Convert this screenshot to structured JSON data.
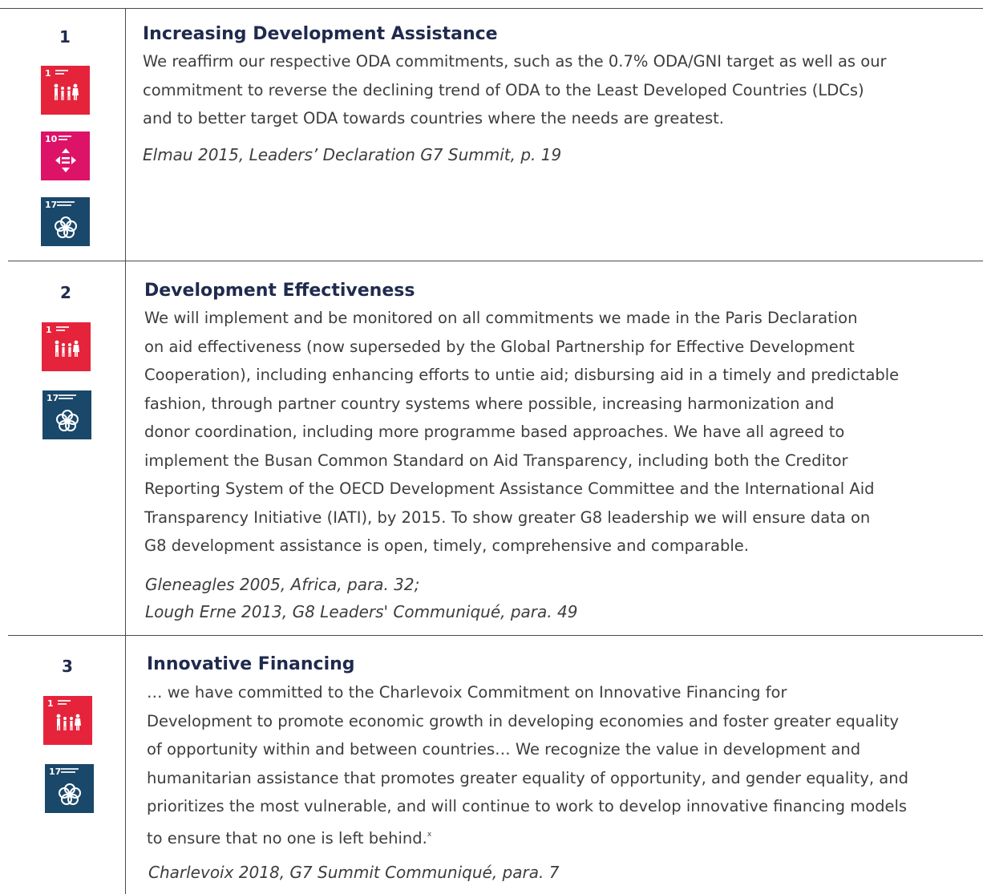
{
  "colors": {
    "sdg1": "#e5243b",
    "sdg10": "#dd1367",
    "sdg17": "#19486a",
    "heading": "#1f2a4d"
  },
  "rows": [
    {
      "number": "1",
      "title": "Increasing Development Assistance",
      "body_lines": [
        "We reaffirm our respective ODA commitments, such as the 0.7% ODA/GNI target as well as our",
        "commitment to reverse the declining trend of ODA to the Least Developed Countries (LDCs)",
        "and to better target ODA towards countries where the needs are greatest."
      ],
      "citation_lines": [
        "Elmau 2015, Leaders’ Declaration G7 Summit, p. 19"
      ],
      "sdg_icons": [
        {
          "goal": "1",
          "icon": "family-icon"
        },
        {
          "goal": "10",
          "icon": "equality-arrows-icon"
        },
        {
          "goal": "17",
          "icon": "flower-icon"
        }
      ]
    },
    {
      "number": "2",
      "title": "Development Effectiveness",
      "body_lines": [
        "We will implement and be monitored on all commitments we made in the Paris Declaration",
        "on aid effectiveness (now superseded by the Global Partnership for Effective Development",
        "Cooperation), including enhancing efforts to untie aid; disbursing aid in a timely and predictable",
        "fashion, through partner country systems where possible, increasing harmonization and",
        "donor coordination, including more programme based approaches. We have all agreed to",
        "implement the Busan Common Standard on Aid Transparency, including both the Creditor",
        "Reporting System of the OECD Development Assistance Committee and the International Aid",
        "Transparency Initiative (IATI), by 2015. To show greater G8 leadership we will ensure data on",
        "G8 development assistance is open, timely, comprehensive and comparable."
      ],
      "citation_lines": [
        "Gleneagles 2005, Africa, para. 32;",
        "Lough Erne 2013, G8 Leaders' Communiqué, para. 49"
      ],
      "sdg_icons": [
        {
          "goal": "1",
          "icon": "family-icon"
        },
        {
          "goal": "17",
          "icon": "flower-icon"
        }
      ]
    },
    {
      "number": "3",
      "title": "Innovative Financing",
      "body_lines": [
        "… we have committed to the Charlevoix Commitment on Innovative Financing for",
        "Development to promote economic growth in developing economies and foster greater equality",
        "of opportunity within and between countries… We recognize the value in development and",
        "humanitarian assistance that promotes greater equality of opportunity, and gender equality, and",
        "prioritizes the most vulnerable, and will continue to work to develop innovative financing models",
        "to ensure that no one is left behind."
      ],
      "footnote_mark": "x",
      "citation_lines": [
        "Charlevoix 2018, G7 Summit Communiqué, para. 7"
      ],
      "sdg_icons": [
        {
          "goal": "1",
          "icon": "family-icon"
        },
        {
          "goal": "17",
          "icon": "flower-icon"
        }
      ]
    }
  ]
}
